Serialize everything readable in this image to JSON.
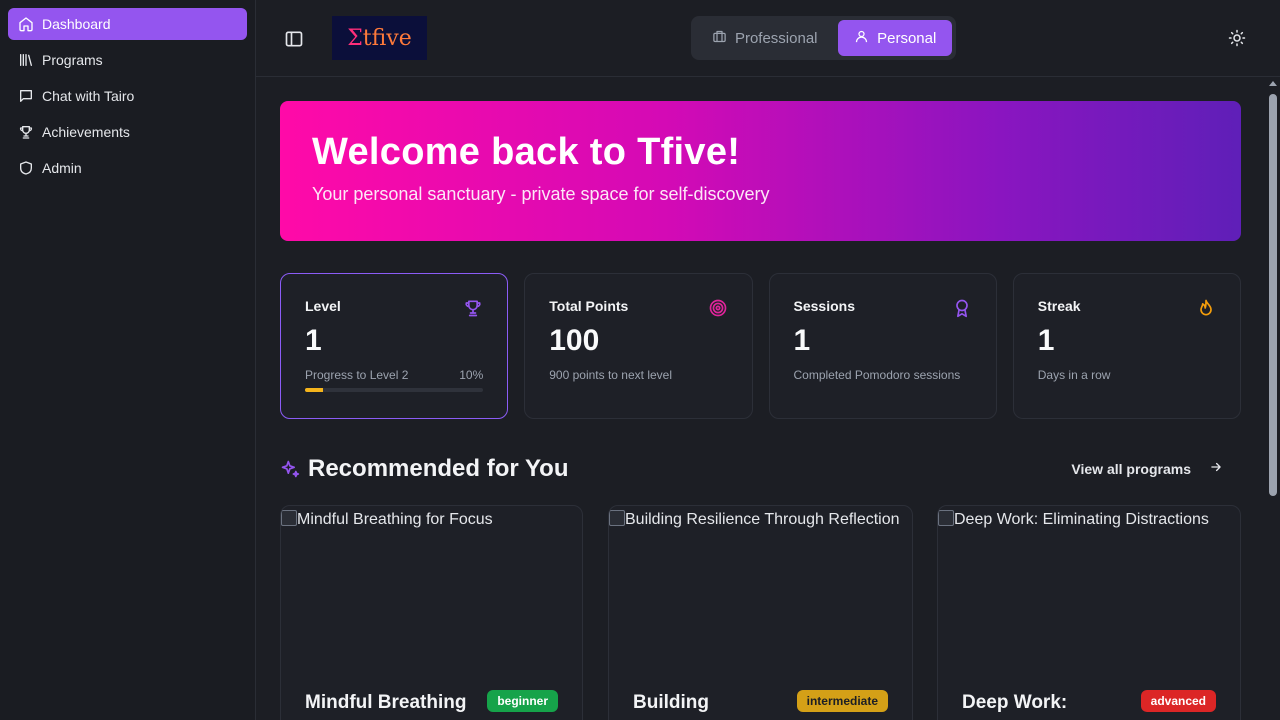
{
  "sidebar": {
    "items": [
      {
        "label": "Dashboard",
        "icon": "home-icon",
        "active": true
      },
      {
        "label": "Programs",
        "icon": "library-icon",
        "active": false
      },
      {
        "label": "Chat with Tairo",
        "icon": "chat-icon",
        "active": false
      },
      {
        "label": "Achievements",
        "icon": "trophy-icon",
        "active": false
      },
      {
        "label": "Admin",
        "icon": "shield-icon",
        "active": false
      }
    ]
  },
  "header": {
    "logo_text_1": "Σ",
    "logo_text_2": "tfive",
    "modes": {
      "professional": "Professional",
      "personal": "Personal"
    },
    "active_mode": "personal"
  },
  "hero": {
    "title": "Welcome back to Tfive!",
    "subtitle": "Your personal sanctuary - private space for self-discovery"
  },
  "stats": {
    "level": {
      "title": "Level",
      "value": "1",
      "progress_label": "Progress to Level 2",
      "progress_text": "10%",
      "progress": 0.1
    },
    "points": {
      "title": "Total Points",
      "value": "100",
      "sub": "900 points to next level"
    },
    "sessions": {
      "title": "Sessions",
      "value": "1",
      "sub": "Completed Pomodoro sessions"
    },
    "streak": {
      "title": "Streak",
      "value": "1",
      "sub": "Days in a row"
    }
  },
  "recommended": {
    "heading": "Recommended for You",
    "view_all": "View all programs",
    "cards": [
      {
        "img_alt": "Mindful Breathing for Focus",
        "title": "Mindful Breathing",
        "level": "beginner"
      },
      {
        "img_alt": "Building Resilience Through Reflection",
        "title": "Building",
        "level": "intermediate"
      },
      {
        "img_alt": "Deep Work: Eliminating Distractions",
        "title": "Deep Work:",
        "level": "advanced"
      }
    ]
  },
  "colors": {
    "accent": "#9455ef",
    "beginner": "#16a34a",
    "intermediate": "#d4a017",
    "advanced": "#dc2626"
  }
}
